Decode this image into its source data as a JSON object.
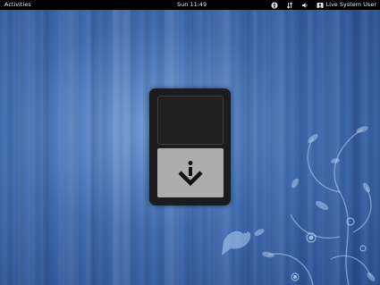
{
  "topbar": {
    "activities_label": "Activities",
    "clock": "Sun 11:49",
    "tray": {
      "accessibility_icon": "accessibility-icon",
      "network_icon": "network-icon",
      "volume_icon": "volume-icon",
      "user_icon": "user-icon",
      "user_name": "Live System User"
    }
  },
  "installer": {
    "install_icon": "download-arrow-icon"
  },
  "colors": {
    "topbar_bg": "#000000",
    "desktop_blue": "#3f6cb0",
    "window_bg": "#1c1c1c",
    "button_bg": "#acacac"
  }
}
